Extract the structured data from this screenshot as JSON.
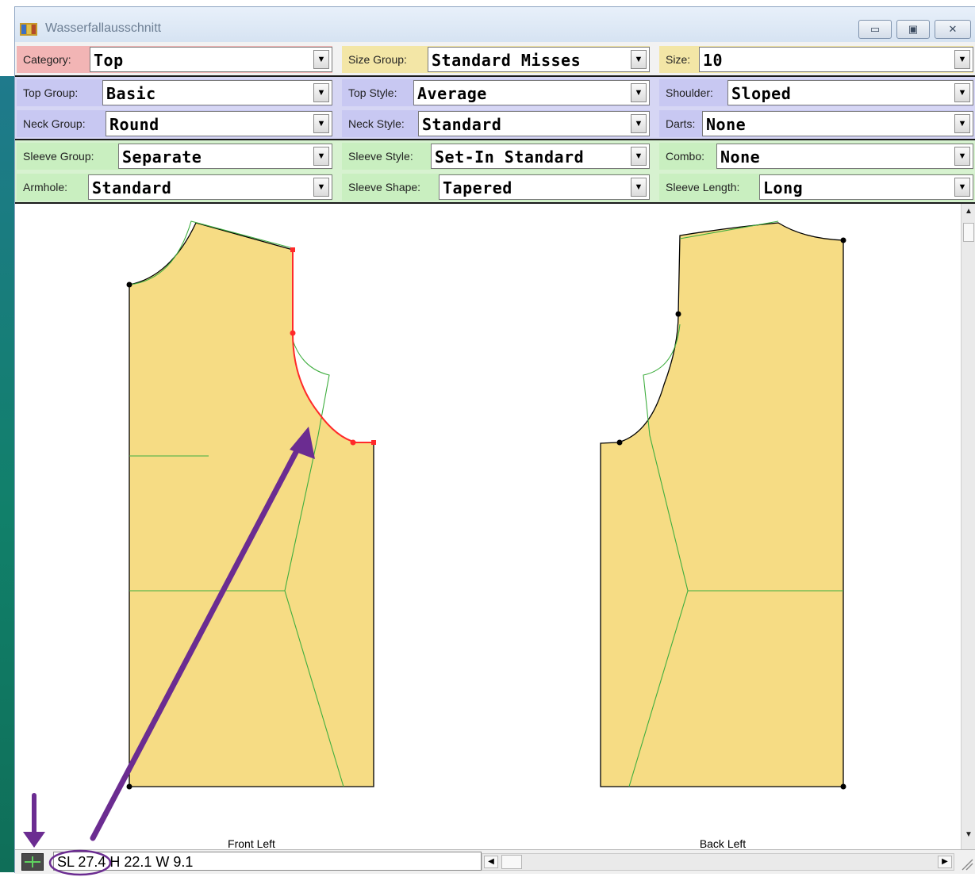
{
  "window": {
    "title": "Wasserfallausschnitt",
    "buttons": {
      "minimize": "▭",
      "maximize": "▣",
      "close": "✕"
    }
  },
  "selectors": {
    "category": {
      "label": "Category:",
      "value": "Top",
      "color": "#f2b5b5"
    },
    "size_group": {
      "label": "Size Group:",
      "value": "Standard Misses",
      "color": "#f3e6a6"
    },
    "size": {
      "label": "Size:",
      "value": "10",
      "color": "#f3e6a6"
    },
    "top_group": {
      "label": "Top Group:",
      "value": "Basic",
      "color": "#c8c8f2"
    },
    "top_style": {
      "label": "Top Style:",
      "value": "Average",
      "color": "#c8c8f2"
    },
    "shoulder": {
      "label": "Shoulder:",
      "value": "Sloped",
      "color": "#c8c8f2"
    },
    "neck_group": {
      "label": "Neck Group:",
      "value": "Round",
      "color": "#c8c8f2"
    },
    "neck_style": {
      "label": "Neck Style:",
      "value": "Standard",
      "color": "#c8c8f2"
    },
    "darts": {
      "label": "Darts:",
      "value": "None",
      "color": "#c8c8f2"
    },
    "sleeve_group": {
      "label": "Sleeve Group:",
      "value": "Separate",
      "color": "#c9efc0"
    },
    "sleeve_style": {
      "label": "Sleeve Style:",
      "value": "Set-In Standard",
      "color": "#c9efc0"
    },
    "combo": {
      "label": "Combo:",
      "value": "None",
      "color": "#c9efc0"
    },
    "armhole": {
      "label": "Armhole:",
      "value": "Standard",
      "color": "#c9efc0"
    },
    "sleeve_shape": {
      "label": "Sleeve Shape:",
      "value": "Tapered",
      "color": "#c9efc0"
    },
    "sleeve_length": {
      "label": "Sleeve Length:",
      "value": "Long",
      "color": "#c9efc0"
    }
  },
  "canvas": {
    "front_label": "Front Left",
    "back_label": "Back Left",
    "fabric_color": "#f6dc84",
    "outline_color": "#000000",
    "guide_color": "#3fae3f",
    "highlight_color": "#ff2a2a",
    "annotation_color": "#6b2c91"
  },
  "status": {
    "text": "SL 27.4  H 22.1  W 9.1",
    "icon": "pattern-tool-icon"
  }
}
